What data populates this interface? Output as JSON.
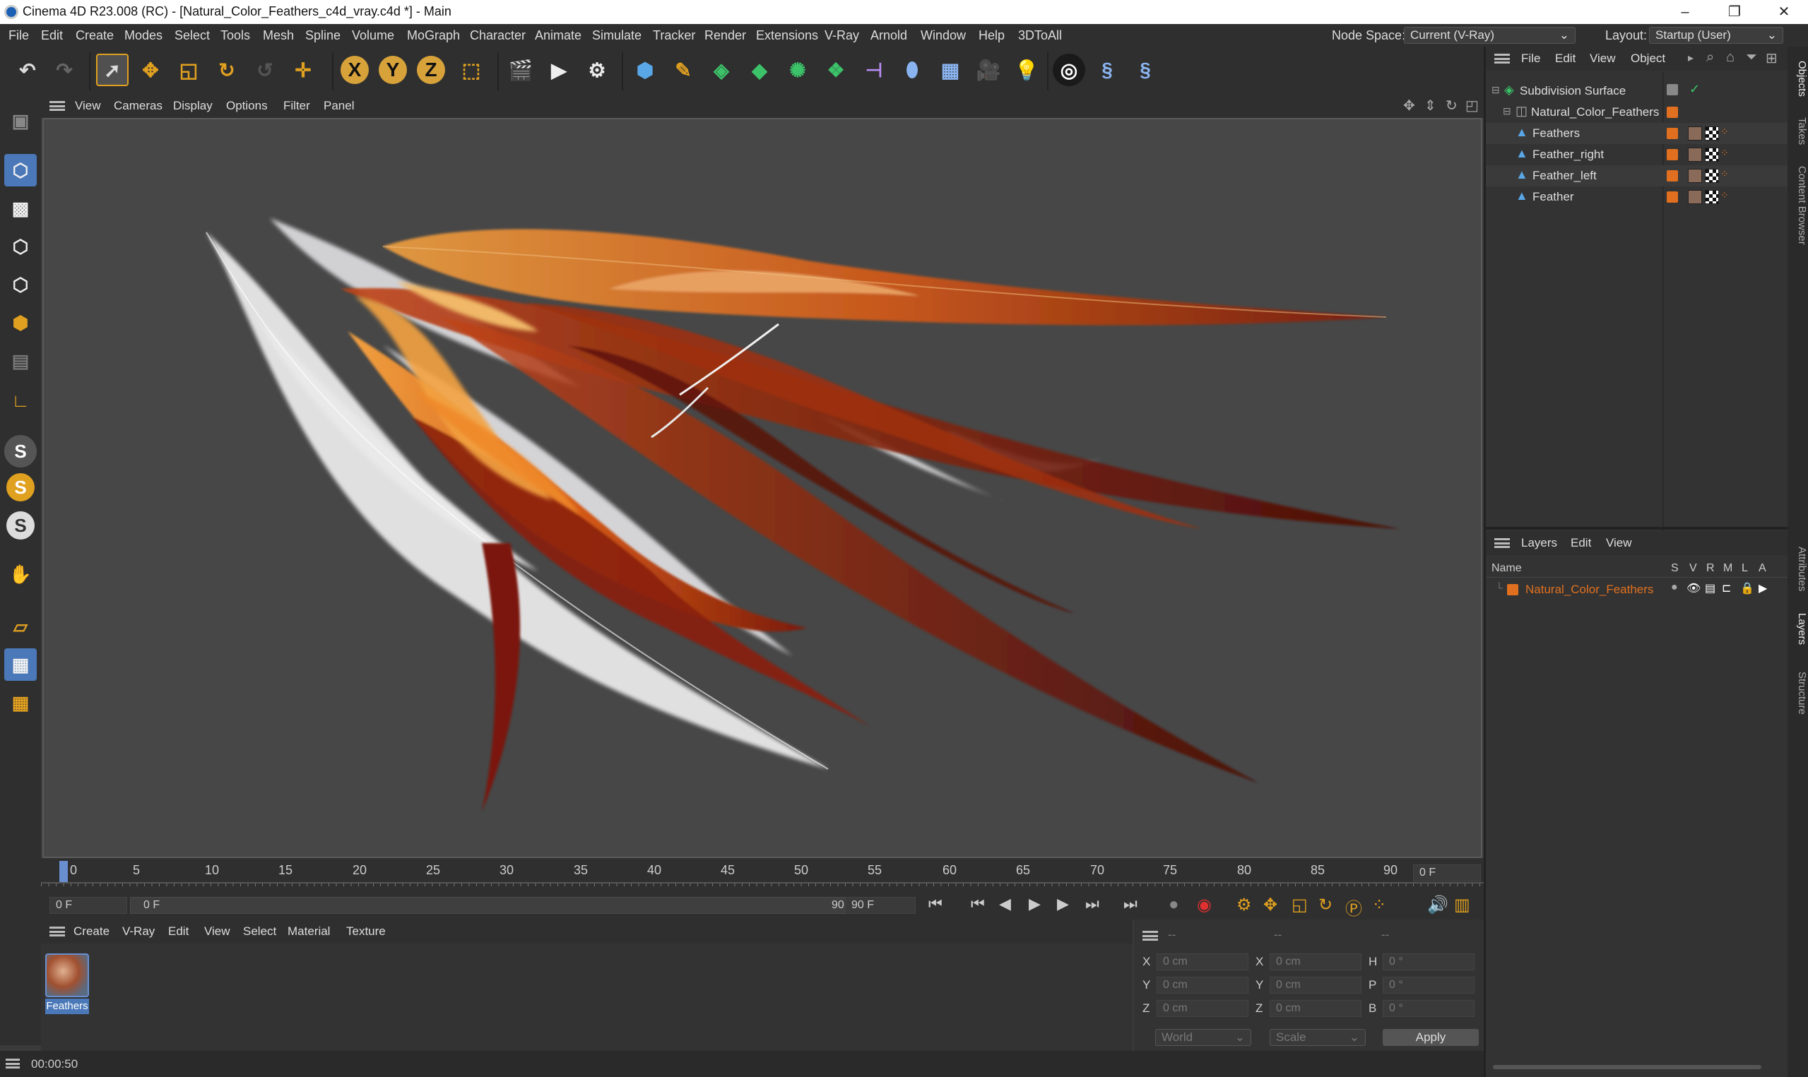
{
  "window": {
    "title": "Cinema 4D R23.008 (RC) - [Natural_Color_Feathers_c4d_vray.c4d *] - Main",
    "minimize": "–",
    "maximize": "❐",
    "close": "✕"
  },
  "menu": [
    "File",
    "Edit",
    "Create",
    "Modes",
    "Select",
    "Tools",
    "Mesh",
    "Spline",
    "Volume",
    "MoGraph",
    "Character",
    "Animate",
    "Simulate",
    "Tracker",
    "Render",
    "Extensions",
    "V-Ray",
    "Arnold",
    "Window",
    "Help",
    "3DToAll"
  ],
  "node_space": {
    "label": "Node Space:",
    "value": "Current (V-Ray)"
  },
  "layout": {
    "label": "Layout:",
    "value": "Startup (User)"
  },
  "viewport_menu": [
    "View",
    "Cameras",
    "Display",
    "Options",
    "Filter",
    "Panel"
  ],
  "objects_menu": [
    "File",
    "Edit",
    "View",
    "Object"
  ],
  "objects": [
    {
      "name": "Subdivision Surface",
      "level": 0
    },
    {
      "name": "Natural_Color_Feathers",
      "level": 1
    },
    {
      "name": "Feathers",
      "level": 2
    },
    {
      "name": "Feather_right",
      "level": 2
    },
    {
      "name": "Feather_left",
      "level": 2
    },
    {
      "name": "Feather",
      "level": 2
    }
  ],
  "layers_menu": [
    "Layers",
    "Edit",
    "View"
  ],
  "layers_header": {
    "name": "Name",
    "cols": [
      "S",
      "V",
      "R",
      "M",
      "L",
      "A"
    ]
  },
  "layers": [
    {
      "name": "Natural_Color_Feathers",
      "color": "#e0701f"
    }
  ],
  "side_tabs": [
    "Objects",
    "Takes",
    "Content Browser",
    "Attributes",
    "Layers",
    "Structure"
  ],
  "timeline": {
    "ticks": [
      "0",
      "5",
      "10",
      "15",
      "20",
      "25",
      "30",
      "35",
      "40",
      "45",
      "50",
      "55",
      "60",
      "65",
      "70",
      "75",
      "80",
      "85",
      "90"
    ],
    "current_frame": "0 F"
  },
  "transport": {
    "start": "0 F",
    "range_start": "0 F",
    "range_end": "90 F",
    "end": "90 F"
  },
  "material_menu": [
    "Create",
    "V-Ray",
    "Edit",
    "View",
    "Select",
    "Material",
    "Texture"
  ],
  "materials": [
    {
      "name": "Feathers"
    }
  ],
  "coords": {
    "header": [
      "--",
      "--",
      "--"
    ],
    "rows": [
      {
        "a": "X",
        "a_val": "0 cm",
        "b": "X",
        "b_val": "0 cm",
        "c": "H",
        "c_val": "0 °"
      },
      {
        "a": "Y",
        "a_val": "0 cm",
        "b": "Y",
        "b_val": "0 cm",
        "c": "P",
        "c_val": "0 °"
      },
      {
        "a": "Z",
        "a_val": "0 cm",
        "b": "Z",
        "b_val": "0 cm",
        "c": "B",
        "c_val": "0 °"
      }
    ],
    "mode1": "World",
    "mode2": "Scale",
    "apply": "Apply"
  },
  "status": {
    "time": "00:00:50"
  },
  "colors": {
    "accent": "#e0701f",
    "selection": "#4a78b8"
  }
}
